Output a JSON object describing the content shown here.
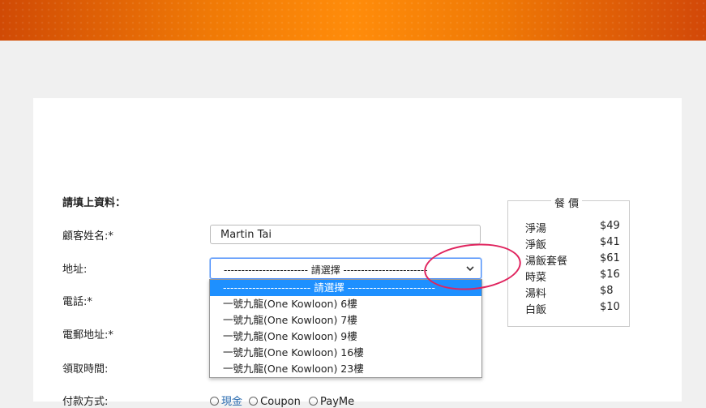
{
  "form": {
    "section_title": "請填上資料：",
    "name_label": "顧客姓名:*",
    "name_value": "Martin Tai",
    "address_label": "地址:",
    "phone_label": "電話:*",
    "email_label": "電郵地址:*",
    "pickup_label": "領取時間:",
    "payment_label": "付款方式:",
    "address_selected": "------------------------ 請選擇 ------------------------",
    "address_options": [
      "------------------------ 請選擇 ------------------------",
      "一號九龍(One Kowloon) 6樓",
      "一號九龍(One Kowloon) 7樓",
      "一號九龍(One Kowloon) 9樓",
      "一號九龍(One Kowloon) 16樓",
      "一號九龍(One Kowloon) 23樓"
    ],
    "payment_options": [
      "現金",
      "Coupon",
      "PayMe"
    ]
  },
  "prices": {
    "title": "餐 價",
    "items": [
      {
        "name": "淨湯",
        "price": "$49"
      },
      {
        "name": "淨飯",
        "price": "$41"
      },
      {
        "name": "湯飯套餐",
        "price": "$61"
      },
      {
        "name": "時菜",
        "price": "$16"
      },
      {
        "name": "湯料",
        "price": "$8"
      },
      {
        "name": "白飯",
        "price": "$10"
      }
    ]
  },
  "colors": {
    "header_orange": "#ff8c0a",
    "selection_blue": "#1e90ff",
    "annotation_circle": "#e0245e"
  }
}
